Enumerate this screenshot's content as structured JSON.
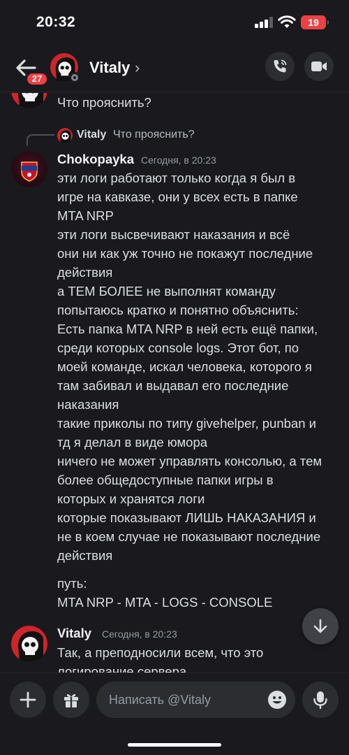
{
  "status_bar": {
    "time": "20:32",
    "battery": "19"
  },
  "header": {
    "unread_badge": "27",
    "contact_name": "Vitaly",
    "chevron": "›",
    "icons": [
      "back-arrow-icon",
      "phone-call-icon",
      "video-camera-icon"
    ]
  },
  "previous_message": {
    "text": "Что прояснить?"
  },
  "reply_reference": {
    "author": "Vitaly",
    "text": "Что прояснить?"
  },
  "message_1": {
    "author": "Chokopayka",
    "timestamp": "Сегодня, в 20:23",
    "lines": [
      "эти логи работают только когда я был в",
      "игре на кавказе, они у всех есть в папке",
      "MTA NRP",
      "эти логи высвечивают наказания и всё",
      "они ни как уж точно не покажут последние",
      "действия",
      "а ТЕМ БОЛЕЕ не выполнят команду",
      "попытаюсь кратко и понятно объяснить:",
      "Есть папка MTA NRP в ней есть ещё папки,",
      "среди которых console logs. Этот бот, по",
      "моей команде, искал человека, которого я",
      "там забивал и выдавал его последние",
      "наказания",
      "такие приколы по типу givehelper, punban и",
      "тд я делал в виде юмора",
      "ничего не может управлять консолью, а тем",
      "более общедоступные папки игры в",
      "которых и хранятся логи",
      "которые показывают ЛИШЬ НАКАЗАНИЯ и",
      "не в коем случае не показывают последние",
      "действия"
    ],
    "path_label": "путь:",
    "path_value": "MTA NRP - MTA - LOGS - CONSOLE"
  },
  "message_2": {
    "author": "Vitaly",
    "timestamp": "Сегодня, в 20:23",
    "lines": [
      "Так, а преподносили всем, что это",
      "логирование сервера"
    ]
  },
  "composer": {
    "placeholder": "Написать @Vitaly",
    "icons": [
      "plus-icon",
      "gift-icon",
      "emoji-icon",
      "microphone-icon"
    ]
  },
  "colors": {
    "background": "#1a1a1e",
    "badge": "#f23f43",
    "avatar_red": "#d0242b",
    "button": "#2b2d31"
  }
}
